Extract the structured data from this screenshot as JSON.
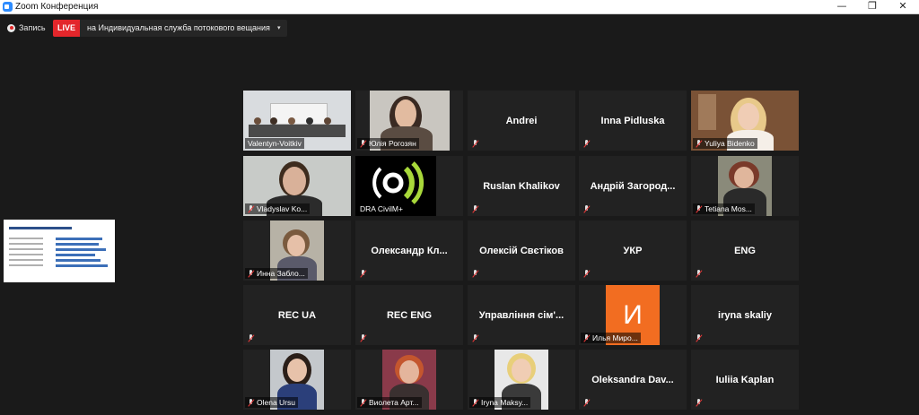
{
  "window": {
    "title": "Zoom Конференция",
    "controls": {
      "minimize": "—",
      "restore": "❐",
      "close": "✕"
    }
  },
  "recording": {
    "label": "Запись"
  },
  "live": {
    "badge": "LIVE",
    "text": "на Индивидуальная служба потокового вещания",
    "caret": "▾"
  },
  "shared_screen": {
    "title": "Динаміка реєстрацій з поїздками 2020 року"
  },
  "participants": [
    {
      "name": "Valentyn-Voitkiv",
      "has_video": true,
      "active": true,
      "muted": false
    },
    {
      "name": "Юлія Рогозян",
      "has_video": true,
      "active": false,
      "muted": true
    },
    {
      "name": "Andrei",
      "has_video": false,
      "active": false,
      "muted": true
    },
    {
      "name": "Inna Pidluska",
      "has_video": false,
      "active": false,
      "muted": true
    },
    {
      "name": "Yuliya Bidenko",
      "has_video": true,
      "active": false,
      "muted": true
    },
    {
      "name": "Vladyslav Ko...",
      "has_video": true,
      "active": false,
      "muted": true
    },
    {
      "name": "DRA CivilM+",
      "has_video": true,
      "active": false,
      "muted": false
    },
    {
      "name": "Ruslan Khalikov",
      "has_video": false,
      "active": false,
      "muted": true
    },
    {
      "name": "Андрій  Загород...",
      "has_video": false,
      "active": false,
      "muted": true
    },
    {
      "name": "Tetiana Mos...",
      "has_video": true,
      "active": false,
      "muted": true
    },
    {
      "name": "Инна Забло...",
      "has_video": true,
      "active": false,
      "muted": true
    },
    {
      "name": "Олександр  Кл...",
      "has_video": false,
      "active": false,
      "muted": true
    },
    {
      "name": "Олексій Свєтіков",
      "has_video": false,
      "active": false,
      "muted": true
    },
    {
      "name": "УКР",
      "has_video": false,
      "active": false,
      "muted": true
    },
    {
      "name": "ENG",
      "has_video": false,
      "active": false,
      "muted": true
    },
    {
      "name": "REC UA",
      "has_video": false,
      "active": false,
      "muted": true
    },
    {
      "name": "REC ENG",
      "has_video": false,
      "active": false,
      "muted": true
    },
    {
      "name": "Управління сім'...",
      "has_video": false,
      "active": false,
      "muted": true
    },
    {
      "name": "Илья Миро...",
      "has_video": true,
      "active": false,
      "muted": true,
      "avatar_letter": "И"
    },
    {
      "name": "iryna skaliy",
      "has_video": false,
      "active": false,
      "muted": true
    },
    {
      "name": "Olena Ursu",
      "has_video": true,
      "active": false,
      "muted": true
    },
    {
      "name": "Виолета Арт...",
      "has_video": true,
      "active": false,
      "muted": true
    },
    {
      "name": "Iryna Maksy...",
      "has_video": true,
      "active": false,
      "muted": true
    },
    {
      "name": "Oleksandra  Dav...",
      "has_video": false,
      "active": false,
      "muted": true
    },
    {
      "name": "Iuliia Kaplan",
      "has_video": false,
      "active": false,
      "muted": true
    }
  ]
}
